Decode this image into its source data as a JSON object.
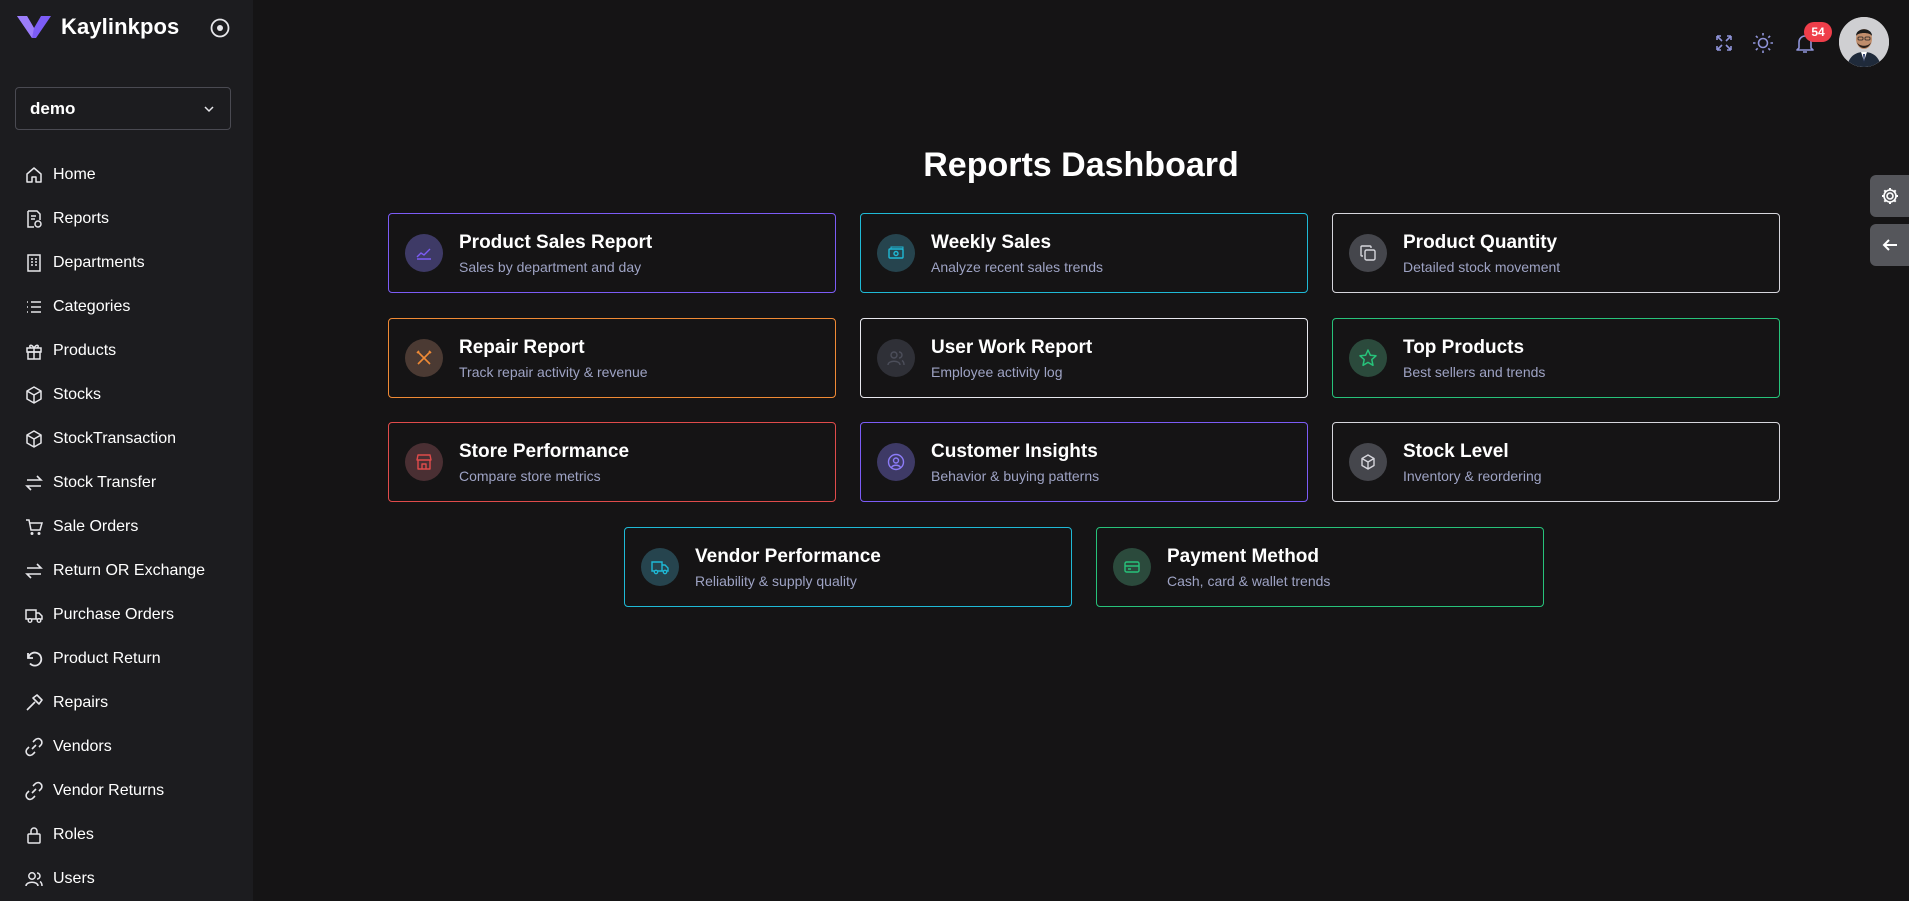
{
  "brand": {
    "name": "Kaylinkpos",
    "logo_icon": "v-logo",
    "accent": "#7c5cf6"
  },
  "store_select": {
    "value": "demo"
  },
  "nav": [
    {
      "label": "Home",
      "icon": "home-icon"
    },
    {
      "label": "Reports",
      "icon": "report-icon"
    },
    {
      "label": "Departments",
      "icon": "building-icon"
    },
    {
      "label": "Categories",
      "icon": "list-icon"
    },
    {
      "label": "Products",
      "icon": "gift-icon"
    },
    {
      "label": "Stocks",
      "icon": "box-icon"
    },
    {
      "label": "StockTransaction",
      "icon": "box-icon"
    },
    {
      "label": "Stock Transfer",
      "icon": "transfer-icon"
    },
    {
      "label": "Sale Orders",
      "icon": "cart-icon"
    },
    {
      "label": "Return OR Exchange",
      "icon": "transfer-icon"
    },
    {
      "label": "Purchase Orders",
      "icon": "truck-icon"
    },
    {
      "label": "Product Return",
      "icon": "undo-icon"
    },
    {
      "label": "Repairs",
      "icon": "hammer-icon"
    },
    {
      "label": "Vendors",
      "icon": "link-icon"
    },
    {
      "label": "Vendor Returns",
      "icon": "link-icon"
    },
    {
      "label": "Roles",
      "icon": "lock-icon"
    },
    {
      "label": "Users",
      "icon": "users-icon"
    }
  ],
  "topbar": {
    "notifications_count": "54"
  },
  "page": {
    "title": "Reports Dashboard"
  },
  "cards": [
    {
      "title": "Product Sales Report",
      "subtitle": "Sales by department and day",
      "color": "#7c5cf6",
      "icon": "chart-line-icon"
    },
    {
      "title": "Weekly Sales",
      "subtitle": "Analyze recent sales trends",
      "color": "#1fb9d6",
      "icon": "cash-icon"
    },
    {
      "title": "Product Quantity",
      "subtitle": "Detailed stock movement",
      "color": "#d6d6dc",
      "icon": "copy-icon"
    },
    {
      "title": "Repair Report",
      "subtitle": "Track repair activity & revenue",
      "color": "#f08a35",
      "icon": "tools-icon"
    },
    {
      "title": "User Work Report",
      "subtitle": "Employee activity log",
      "color": "#e8e8ee",
      "icon": "users-icon"
    },
    {
      "title": "Top Products",
      "subtitle": "Best sellers and trends",
      "color": "#27c27a",
      "icon": "star-icon"
    },
    {
      "title": "Store Performance",
      "subtitle": "Compare store metrics",
      "color": "#e04b4b",
      "icon": "store-icon"
    },
    {
      "title": "Customer Insights",
      "subtitle": "Behavior & buying patterns",
      "color": "#7c5cf6",
      "icon": "user-circle-icon"
    },
    {
      "title": "Stock Level",
      "subtitle": "Inventory & reordering",
      "color": "#d6d6dc",
      "icon": "cube-icon"
    },
    {
      "title": "Vendor Performance",
      "subtitle": "Reliability & supply quality",
      "color": "#1fb9d6",
      "icon": "truck-icon"
    },
    {
      "title": "Payment Method",
      "subtitle": "Cash, card & wallet trends",
      "color": "#27c27a",
      "icon": "card-icon"
    }
  ]
}
